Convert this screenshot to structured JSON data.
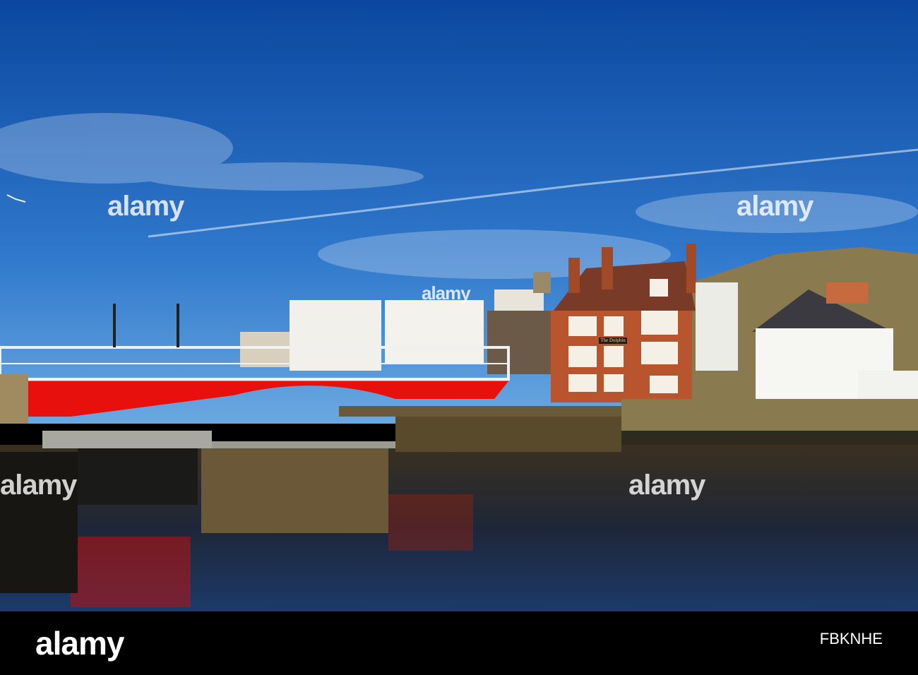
{
  "photo": {
    "sign_text": "The Dolphin",
    "watermark": "alamy"
  },
  "footer": {
    "logo": "alamy",
    "image_id": "FBKNHE"
  },
  "colors": {
    "sky_top": "#0d4fa8",
    "sky_bottom": "#4a93d8",
    "bridge_red": "#e8100c",
    "brick": "#b8552e",
    "water": "#2a2218"
  }
}
